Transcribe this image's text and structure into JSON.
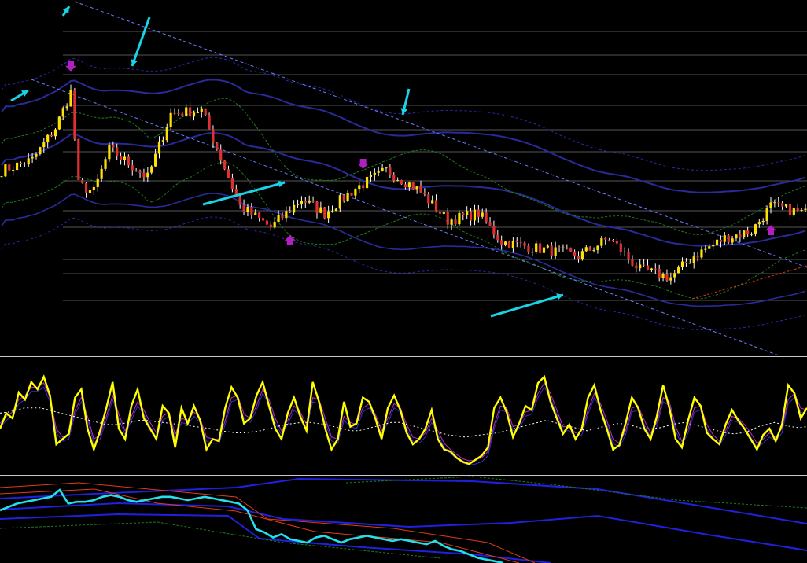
{
  "colors": {
    "background": "#000000",
    "separator": "#c8c8c8",
    "gridline": "#9a9a9a",
    "candle_up": "#ffe000",
    "candle_down": "#e03030",
    "wick": "#ffffff",
    "band_navy": "#2a2a9a",
    "band_dash": "#2a2ab0",
    "band_green": "#1f7a1f",
    "channel_dash": "#6a7dff",
    "annotation_arrow": "#19d3e6",
    "signal_purple": "#b020c0",
    "signal_blue": "#3a6bff",
    "osc_main": "#ffff00",
    "osc_signal": "#c02ac8",
    "osc_blue": "#3030c8",
    "osc_dotted": "#ffffff",
    "lower_main": "#22e0ee",
    "lower_band": "#2020e0",
    "lower_red": "#e03a1a",
    "lower_green": "#1f7a1f",
    "diag_red_dash": "#d03a1a"
  },
  "chart_data": [
    {
      "type": "candlestick",
      "description_panel": "price",
      "bar_count": 210,
      "close_path": [
        [
          0,
          52
        ],
        [
          8,
          55
        ],
        [
          14,
          64
        ],
        [
          18,
          74
        ],
        [
          20,
          48
        ],
        [
          24,
          46
        ],
        [
          28,
          58
        ],
        [
          33,
          54
        ],
        [
          38,
          50
        ],
        [
          44,
          68
        ],
        [
          52,
          69
        ],
        [
          62,
          42
        ],
        [
          70,
          36
        ],
        [
          78,
          44
        ],
        [
          84,
          40
        ],
        [
          92,
          47
        ],
        [
          100,
          52
        ],
        [
          108,
          47
        ],
        [
          116,
          38
        ],
        [
          124,
          40
        ],
        [
          130,
          32
        ],
        [
          140,
          30
        ],
        [
          150,
          28
        ],
        [
          158,
          33
        ],
        [
          166,
          24
        ],
        [
          174,
          22
        ],
        [
          180,
          28
        ],
        [
          188,
          33
        ],
        [
          195,
          35
        ],
        [
          200,
          42
        ],
        [
          209,
          40
        ]
      ],
      "y_range": [
        0,
        100
      ],
      "signal_arrows_down_bar": [
        18,
        94
      ],
      "signal_arrows_up_bar": [
        75,
        200
      ]
    },
    {
      "type": "line",
      "description_panel": "oscillator",
      "y_range": [
        0,
        100
      ],
      "series_main": [
        40,
        55,
        50,
        75,
        68,
        85,
        78,
        90,
        72,
        25,
        30,
        35,
        70,
        78,
        40,
        20,
        38,
        60,
        85,
        40,
        30,
        62,
        78,
        50,
        40,
        30,
        62,
        55,
        22,
        60,
        45,
        62,
        48,
        20,
        30,
        28,
        60,
        80,
        70,
        45,
        50,
        72,
        85,
        62,
        40,
        30,
        55,
        70,
        52,
        38,
        85,
        66,
        40,
        20,
        30,
        66,
        42,
        45,
        70,
        66,
        50,
        30,
        60,
        72,
        58,
        36,
        25,
        30,
        40,
        58,
        30,
        20,
        18,
        12,
        8,
        6,
        10,
        14,
        22,
        60,
        70,
        56,
        32,
        45,
        62,
        58,
        84,
        90,
        66,
        50,
        35,
        44,
        30,
        40,
        70,
        82,
        58,
        40,
        20,
        24,
        45,
        70,
        60,
        40,
        30,
        52,
        82,
        60,
        30,
        22,
        48,
        70,
        62,
        36,
        30,
        25,
        44,
        58,
        48,
        40,
        30,
        20,
        34,
        40,
        28,
        44,
        82,
        74,
        50,
        60
      ],
      "series_signal": [
        45,
        52,
        56,
        68,
        72,
        80,
        80,
        84,
        70,
        40,
        32,
        34,
        58,
        70,
        52,
        30,
        34,
        52,
        72,
        54,
        38,
        52,
        66,
        58,
        46,
        36,
        52,
        56,
        34,
        50,
        48,
        56,
        50,
        32,
        30,
        30,
        48,
        70,
        72,
        54,
        50,
        62,
        78,
        68,
        50,
        38,
        48,
        62,
        56,
        44,
        70,
        68,
        50,
        32,
        30,
        52,
        46,
        44,
        60,
        64,
        54,
        38,
        50,
        64,
        60,
        44,
        32,
        30,
        36,
        50,
        38,
        26,
        20,
        15,
        11,
        9,
        10,
        12,
        18,
        44,
        62,
        60,
        42,
        44,
        56,
        58,
        74,
        84,
        74,
        58,
        42,
        42,
        36,
        38,
        58,
        74,
        64,
        48,
        30,
        26,
        38,
        60,
        62,
        48,
        36,
        46,
        70,
        66,
        42,
        28,
        40,
        60,
        62,
        44,
        34,
        28,
        38,
        52,
        50,
        44,
        36,
        26,
        30,
        36,
        32,
        40,
        68,
        74,
        60,
        58
      ],
      "series_dotted": [
        55,
        56,
        58,
        60,
        60,
        60,
        58,
        56,
        54,
        52,
        50,
        48,
        46,
        44,
        44,
        45,
        46,
        48,
        48,
        47,
        46,
        45,
        44,
        43,
        42,
        41,
        40,
        38,
        37,
        36,
        36,
        37,
        38,
        40,
        42,
        44,
        45,
        46,
        46,
        45,
        44,
        42,
        40,
        38,
        38,
        40,
        42,
        44,
        46,
        46,
        44,
        42,
        40,
        38,
        36,
        34,
        33,
        32,
        33,
        34,
        35,
        36,
        38,
        40,
        42,
        44,
        46,
        48,
        46,
        44,
        42,
        40,
        38,
        40,
        42,
        44,
        45,
        44,
        42,
        40,
        40,
        41,
        43,
        45,
        46,
        44,
        42,
        40,
        38,
        36,
        35,
        36,
        38,
        42,
        44,
        46,
        44,
        42,
        41,
        42
      ]
    },
    {
      "type": "line",
      "description_panel": "lower-indicator",
      "y_range": [
        0,
        100
      ],
      "series_main": [
        62,
        66,
        70,
        72,
        74,
        76,
        78,
        86,
        70,
        72,
        72,
        74,
        78,
        80,
        78,
        74,
        72,
        74,
        76,
        78,
        78,
        76,
        74,
        76,
        78,
        76,
        74,
        72,
        70,
        62,
        40,
        36,
        30,
        34,
        28,
        26,
        24,
        30,
        32,
        28,
        24,
        28,
        30,
        32,
        30,
        28,
        26,
        28,
        26,
        24,
        22,
        26,
        20,
        16,
        14,
        10,
        6,
        4,
        2,
        0
      ]
    }
  ],
  "annotations": {
    "arrow_count": 6,
    "price_gridlines_y": [
      40,
      70,
      95,
      134,
      165,
      193,
      230,
      268,
      289,
      330,
      348,
      382
    ]
  }
}
